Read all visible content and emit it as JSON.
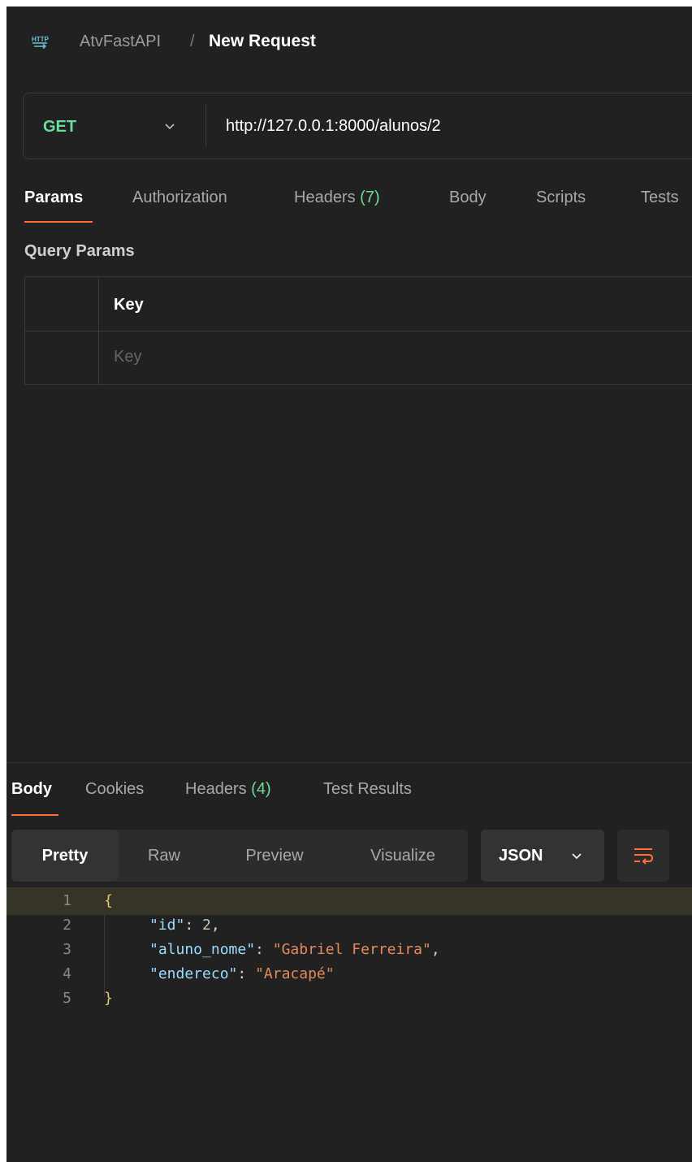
{
  "header": {
    "icon": "http-icon",
    "collection": "AtvFastAPI",
    "separator": "/",
    "request_name": "New Request"
  },
  "request": {
    "method": "GET",
    "url": "http://127.0.0.1:8000/alunos/2"
  },
  "request_tabs": [
    {
      "label": "Params",
      "active": true
    },
    {
      "label": "Authorization"
    },
    {
      "label": "Headers",
      "count": "(7)"
    },
    {
      "label": "Body"
    },
    {
      "label": "Scripts"
    },
    {
      "label": "Tests"
    }
  ],
  "query_params": {
    "title": "Query Params",
    "column_header": "Key",
    "key_placeholder": "Key"
  },
  "response_tabs": [
    {
      "label": "Body",
      "active": true
    },
    {
      "label": "Cookies"
    },
    {
      "label": "Headers",
      "count": "(4)"
    },
    {
      "label": "Test Results"
    }
  ],
  "response_view": {
    "modes": [
      "Pretty",
      "Raw",
      "Preview",
      "Visualize"
    ],
    "active_mode": "Pretty",
    "format": "JSON"
  },
  "response_body": {
    "line_numbers": [
      "1",
      "2",
      "3",
      "4",
      "5"
    ],
    "open_brace": "{",
    "close_brace": "}",
    "fields": [
      {
        "key": "\"id\"",
        "value": "2",
        "type": "number",
        "comma": ","
      },
      {
        "key": "\"aluno_nome\"",
        "value": "\"Gabriel Ferreira\"",
        "type": "string",
        "comma": ","
      },
      {
        "key": "\"endereco\"",
        "value": "\"Aracapé\"",
        "type": "string",
        "comma": ""
      }
    ]
  },
  "colors": {
    "background": "#212121",
    "method_get": "#6bdd9a",
    "tab_underline": "#ff6c37",
    "count_badge": "#6bdd9a",
    "json_key": "#9cdcfe",
    "json_string": "#e48b5e",
    "json_number": "#b5cea8"
  }
}
